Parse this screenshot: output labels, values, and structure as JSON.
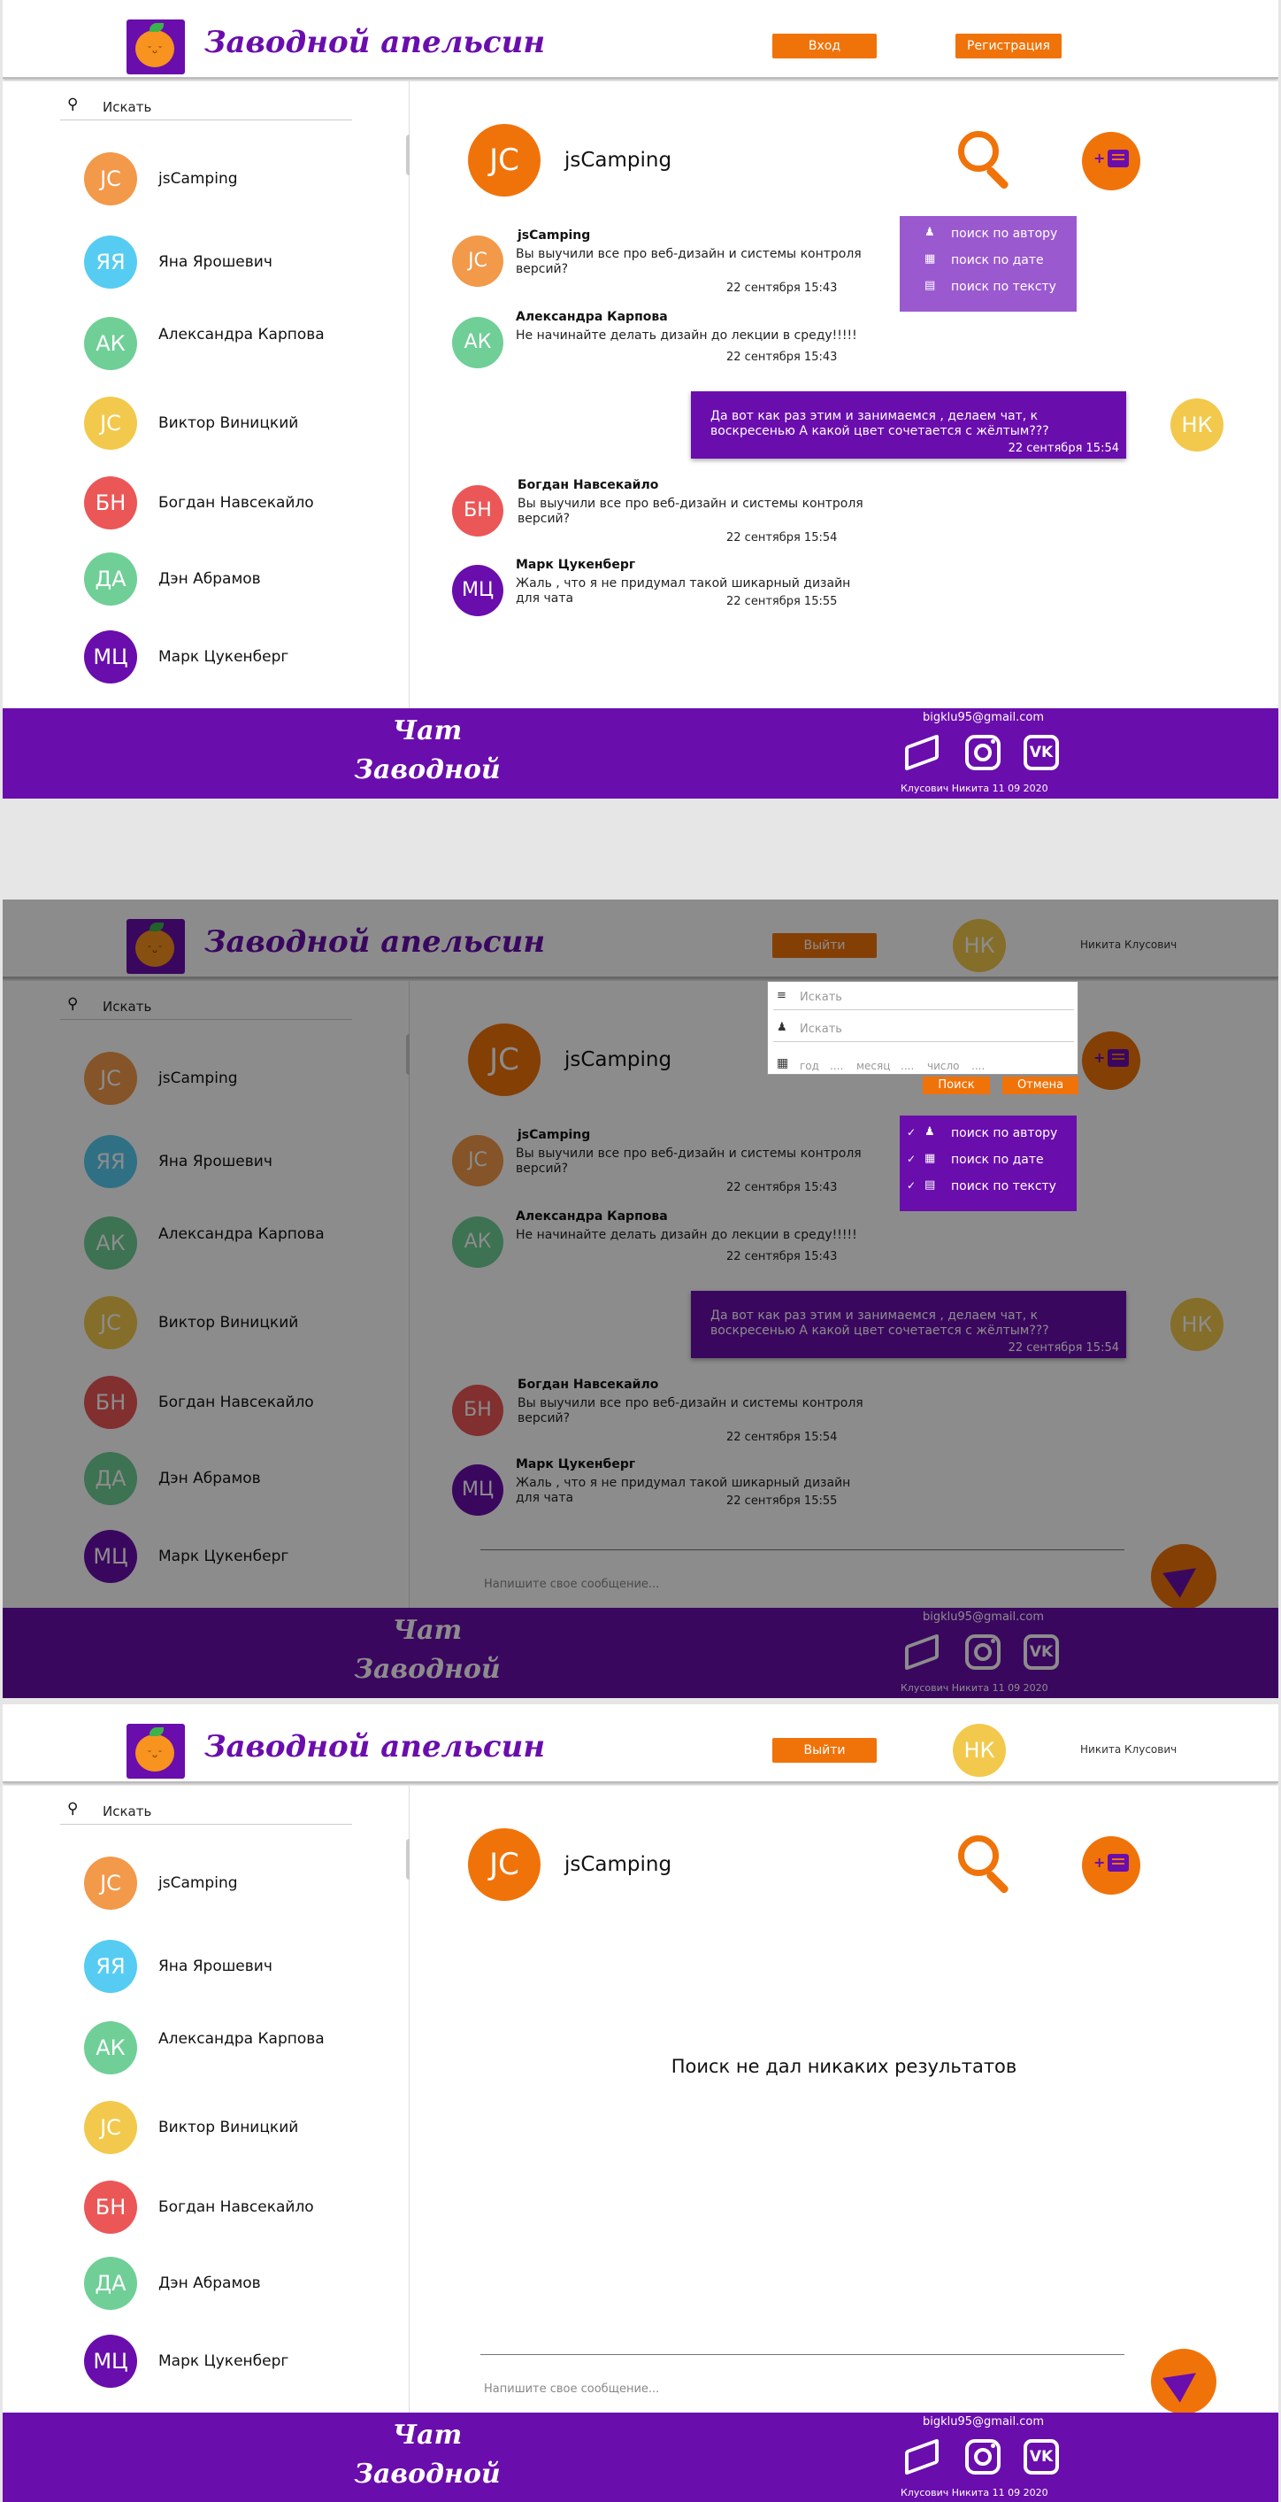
{
  "brand": "Заводной апельсин",
  "logo_face": "˘ᴗ˘",
  "header": {
    "login": "Вход",
    "register": "Регистрация",
    "logout": "Выйти",
    "user_initials": "НК",
    "user_name": "Никита Клусович"
  },
  "search": {
    "icon": "search-icon",
    "label": "Искать"
  },
  "contacts": [
    {
      "initials": "JC",
      "name": "jsCamping",
      "color": "#f2994a"
    },
    {
      "initials": "ЯЯ",
      "name": "Яна Ярошевич",
      "color": "#56ccf2"
    },
    {
      "initials": "АК",
      "name": "Александра Карпова",
      "color": "#6fcf97"
    },
    {
      "initials": "JC",
      "name": "Виктор Виницкий",
      "color": "#f2c94c"
    },
    {
      "initials": "БН",
      "name": "Богдан Навсекайло",
      "color": "#eb5757"
    },
    {
      "initials": "ДА",
      "name": "Дэн Абрамов",
      "color": "#6fcf97"
    },
    {
      "initials": "МЦ",
      "name": "Марк Цукенберг",
      "color": "#6a0dad"
    }
  ],
  "chat": {
    "initials": "JC",
    "title": "jsCamping",
    "filters": [
      "поиск по автору",
      "поиск по дате",
      "поиск по  тексту"
    ],
    "messages": [
      {
        "initials": "JC",
        "author": "jsCamping",
        "text": "Вы выучили все про веб-дизайн и системы контроля версий?",
        "time": "22 сентября 15:43",
        "color": "#f2994a"
      },
      {
        "initials": "АК",
        "author": "Александра Карпова",
        "text": "Не начинайте делать дизайн до лекции в среду!!!!!",
        "time": "22 сентября 15:43",
        "color": "#6fcf97"
      },
      {
        "initials": "БН",
        "author": "Богдан Навсекайло",
        "text": "Вы выучили все про веб-дизайн и системы контроля версий?",
        "time": "22 сентября 15:54",
        "color": "#eb5757"
      },
      {
        "initials": "МЦ",
        "author": "Марк Цукенберг",
        "text": "Жаль , что я не придумал такой шикарный  дизайн для чата",
        "time": "22 сентября 15:55",
        "color": "#6a0dad"
      }
    ],
    "own_message": {
      "text": "Да вот как раз этим и занимаемся , делаем чат, к воскресенью А какой цвет сочетается с жёлтым???",
      "time": "22 сентября  15:54",
      "initials": "НК"
    },
    "input_placeholder": "Напишите свое сообщение...",
    "empty_result": "Поиск не дал никаких результатов"
  },
  "search_popup": {
    "text_placeholder": "Искать",
    "author_placeholder": "Искать",
    "year": "год",
    "month": "месяц",
    "number": "число",
    "dots": "....",
    "search_button": "Поиск",
    "cancel_button": "Отмена"
  },
  "footer": {
    "title_line1": "Чат",
    "title_line2": "Заводной апельсин",
    "email": "bigklu95@gmail.com",
    "copyright": "Клусович Никита  11 09 2020",
    "vk": "VK"
  },
  "colors": {
    "accent": "#f0730a",
    "brand": "#6a0dad",
    "menu_light": "#9b59d0"
  }
}
